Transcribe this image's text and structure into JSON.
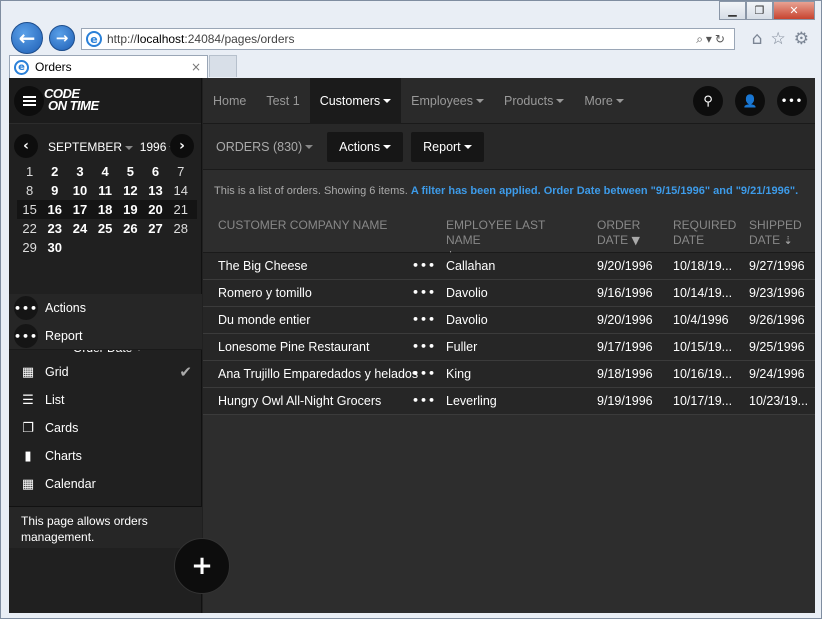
{
  "browser": {
    "url_prefix": "http://",
    "url_host": "localhost",
    "url_rest": ":24084/pages/orders",
    "tab_title": "Orders",
    "tab_close": "×",
    "min_glyph": "▁",
    "max_glyph": "❐",
    "close_glyph": "✕",
    "back_glyph": "←",
    "fwd_glyph": "→",
    "address_tools": "⌕▾↻",
    "home_glyph": "⌂",
    "fav_glyph": "☆",
    "settings_glyph": "⚙"
  },
  "logo": {
    "line1": "CODE",
    "line2": "ON TIME"
  },
  "calendar": {
    "month": "SEPTEMBER",
    "year": "1996",
    "prev_glyph": "‹",
    "next_glyph": "›",
    "weeks": [
      [
        {
          "d": "1",
          "b": false
        },
        {
          "d": "2",
          "b": true
        },
        {
          "d": "3",
          "b": true
        },
        {
          "d": "4",
          "b": true
        },
        {
          "d": "5",
          "b": true
        },
        {
          "d": "6",
          "b": true
        },
        {
          "d": "7",
          "b": false
        }
      ],
      [
        {
          "d": "8",
          "b": false
        },
        {
          "d": "9",
          "b": true
        },
        {
          "d": "10",
          "b": true
        },
        {
          "d": "11",
          "b": true
        },
        {
          "d": "12",
          "b": true
        },
        {
          "d": "13",
          "b": true
        },
        {
          "d": "14",
          "b": false
        }
      ],
      [
        {
          "d": "15",
          "b": false
        },
        {
          "d": "16",
          "b": true
        },
        {
          "d": "17",
          "b": true
        },
        {
          "d": "18",
          "b": true
        },
        {
          "d": "19",
          "b": true
        },
        {
          "d": "20",
          "b": true
        },
        {
          "d": "21",
          "b": false
        }
      ],
      [
        {
          "d": "22",
          "b": false
        },
        {
          "d": "23",
          "b": true
        },
        {
          "d": "24",
          "b": true
        },
        {
          "d": "25",
          "b": true
        },
        {
          "d": "26",
          "b": true
        },
        {
          "d": "27",
          "b": true
        },
        {
          "d": "28",
          "b": false
        }
      ],
      [
        {
          "d": "29",
          "b": false
        },
        {
          "d": "30",
          "b": true
        },
        {
          "d": "",
          "b": false
        },
        {
          "d": "",
          "b": false
        },
        {
          "d": "",
          "b": false
        },
        {
          "d": "",
          "b": false
        },
        {
          "d": "",
          "b": false
        }
      ]
    ],
    "field_label": "Order Date"
  },
  "sidebar": {
    "actions": [
      {
        "label": "Actions",
        "icon": "•••"
      },
      {
        "label": "Report",
        "icon": "•••"
      }
    ],
    "views": [
      {
        "label": "Grid",
        "icon": "▦",
        "name": "grid-icon",
        "checked": true
      },
      {
        "label": "List",
        "icon": "☰",
        "name": "list-icon",
        "checked": false
      },
      {
        "label": "Cards",
        "icon": "❐",
        "name": "cards-icon",
        "checked": false
      },
      {
        "label": "Charts",
        "icon": "▮",
        "name": "chart-icon",
        "checked": false
      },
      {
        "label": "Calendar",
        "icon": "▦",
        "name": "calendar-icon",
        "checked": false
      }
    ],
    "check_glyph": "✔",
    "description": "This page allows orders management.",
    "fab_glyph": "+"
  },
  "topnav": {
    "items": [
      {
        "label": "Home",
        "active": false,
        "caret": false
      },
      {
        "label": "Test 1",
        "active": false,
        "caret": false
      },
      {
        "label": "Customers",
        "active": true,
        "caret": true
      },
      {
        "label": "Employees",
        "active": false,
        "caret": true
      },
      {
        "label": "Products",
        "active": false,
        "caret": true
      },
      {
        "label": "More",
        "active": false,
        "caret": true
      }
    ],
    "search_glyph": "⚲",
    "user_glyph": "👤",
    "more_glyph": "•••"
  },
  "toolbar": {
    "title": "ORDERS (830)",
    "actions_label": "Actions",
    "report_label": "Report"
  },
  "info": {
    "text": "This is a list of orders. Showing 6 items. ",
    "filter": "A filter has been applied. Order Date between \"9/15/1996\" and \"9/21/1996\"."
  },
  "grid": {
    "columns": {
      "company": "CUSTOMER COMPANY NAME",
      "employee": "EMPLOYEE LAST NAME",
      "order_date_1": "ORDER",
      "order_date_2": "DATE",
      "required_1": "REQUIRED",
      "required_2": "DATE",
      "shipped_1": "SHIPPED",
      "shipped_2": "DATE"
    },
    "sort_glyph": "⇣",
    "filter_glyph": "▼",
    "row_dots": "•••",
    "rows": [
      {
        "company": "The Big Cheese",
        "employee": "Callahan",
        "order_date": "9/20/1996",
        "required": "10/18/19...",
        "shipped": "9/27/1996"
      },
      {
        "company": "Romero y tomillo",
        "employee": "Davolio",
        "order_date": "9/16/1996",
        "required": "10/14/19...",
        "shipped": "9/23/1996"
      },
      {
        "company": "Du monde entier",
        "employee": "Davolio",
        "order_date": "9/20/1996",
        "required": "10/4/1996",
        "shipped": "9/26/1996"
      },
      {
        "company": "Lonesome Pine Restaurant",
        "employee": "Fuller",
        "order_date": "9/17/1996",
        "required": "10/15/19...",
        "shipped": "9/25/1996"
      },
      {
        "company": "Ana Trujillo Emparedados y helados",
        "employee": "King",
        "order_date": "9/18/1996",
        "required": "10/16/19...",
        "shipped": "9/24/1996"
      },
      {
        "company": "Hungry Owl All-Night Grocers",
        "employee": "Leverling",
        "order_date": "9/19/1996",
        "required": "10/17/19...",
        "shipped": "10/23/19..."
      }
    ]
  }
}
